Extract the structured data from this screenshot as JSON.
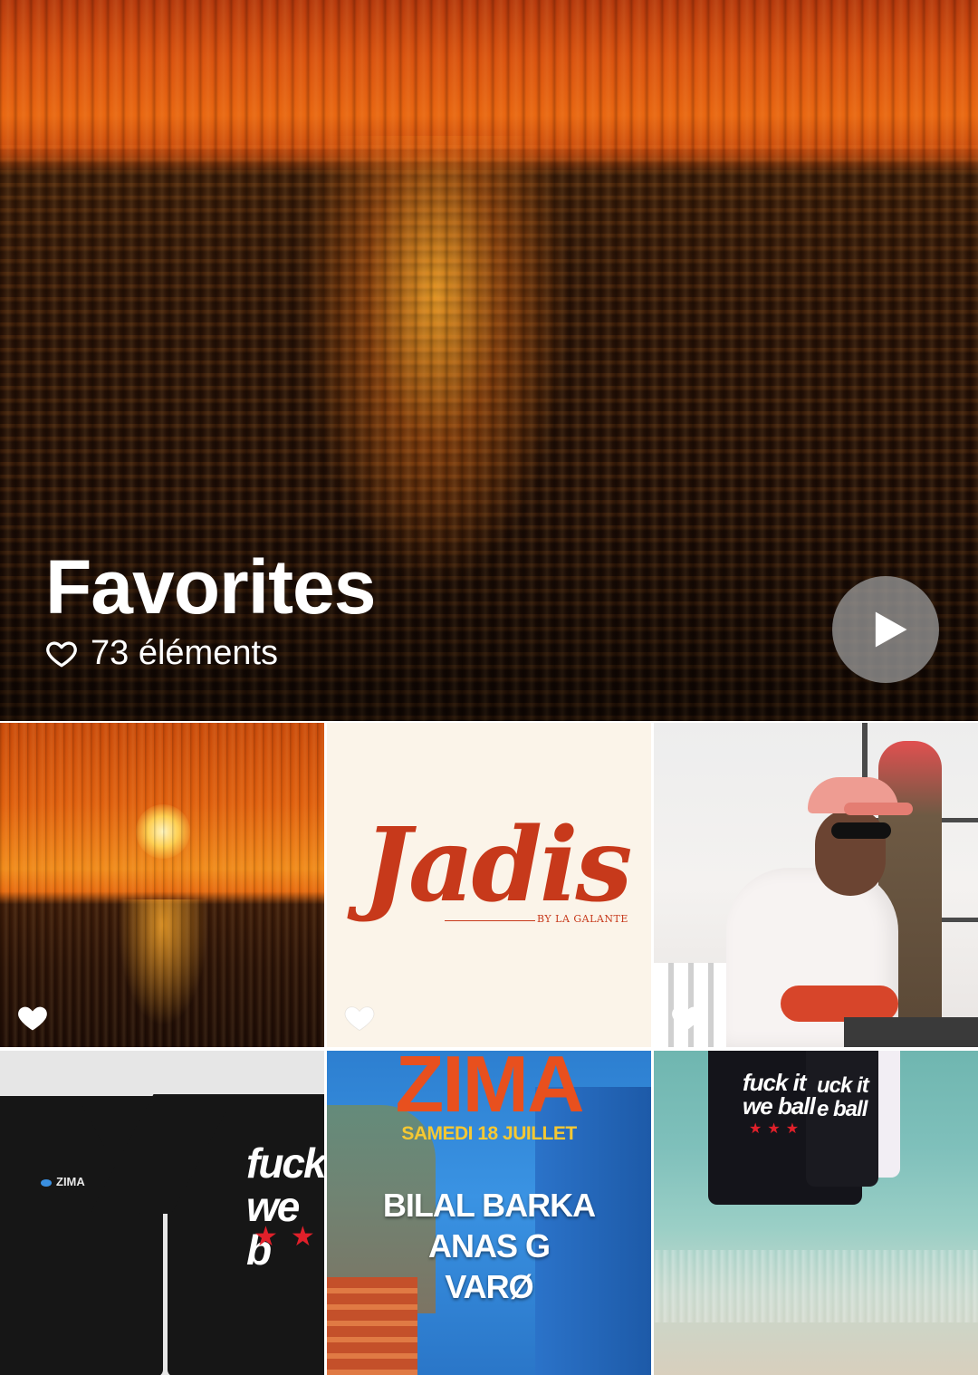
{
  "album": {
    "title": "Favorites",
    "count_label": "73 éléments",
    "icons": {
      "count": "heart-outline-icon",
      "play": "play-icon"
    }
  },
  "grid": {
    "tiles": [
      {
        "kind": "sunset-photo",
        "favorited": true
      },
      {
        "kind": "logo",
        "favorited": true,
        "logo_text": "Jadis",
        "logo_subtitle": "BY LA GALANTE"
      },
      {
        "kind": "dj-photo",
        "favorited": true
      },
      {
        "kind": "tshirt-photo",
        "favorited": false,
        "brand": "ZIMA",
        "print_line1": "fuck",
        "print_line2": "we b"
      },
      {
        "kind": "poster",
        "favorited": false,
        "title": "ZIMA",
        "date": "SAMEDI 18 JUILLET",
        "lineup": [
          "BILAL BARKA",
          "ANAS G",
          "VARØ"
        ]
      },
      {
        "kind": "beach-photo",
        "favorited": false,
        "print_line1": "fuck it",
        "print_line2": "we ball",
        "print_side1": "uck it",
        "print_side2": "e ball"
      }
    ]
  },
  "colors": {
    "accent_red": "#c7391b",
    "poster_orange": "#e8501e",
    "poster_yellow": "#f6c832"
  }
}
